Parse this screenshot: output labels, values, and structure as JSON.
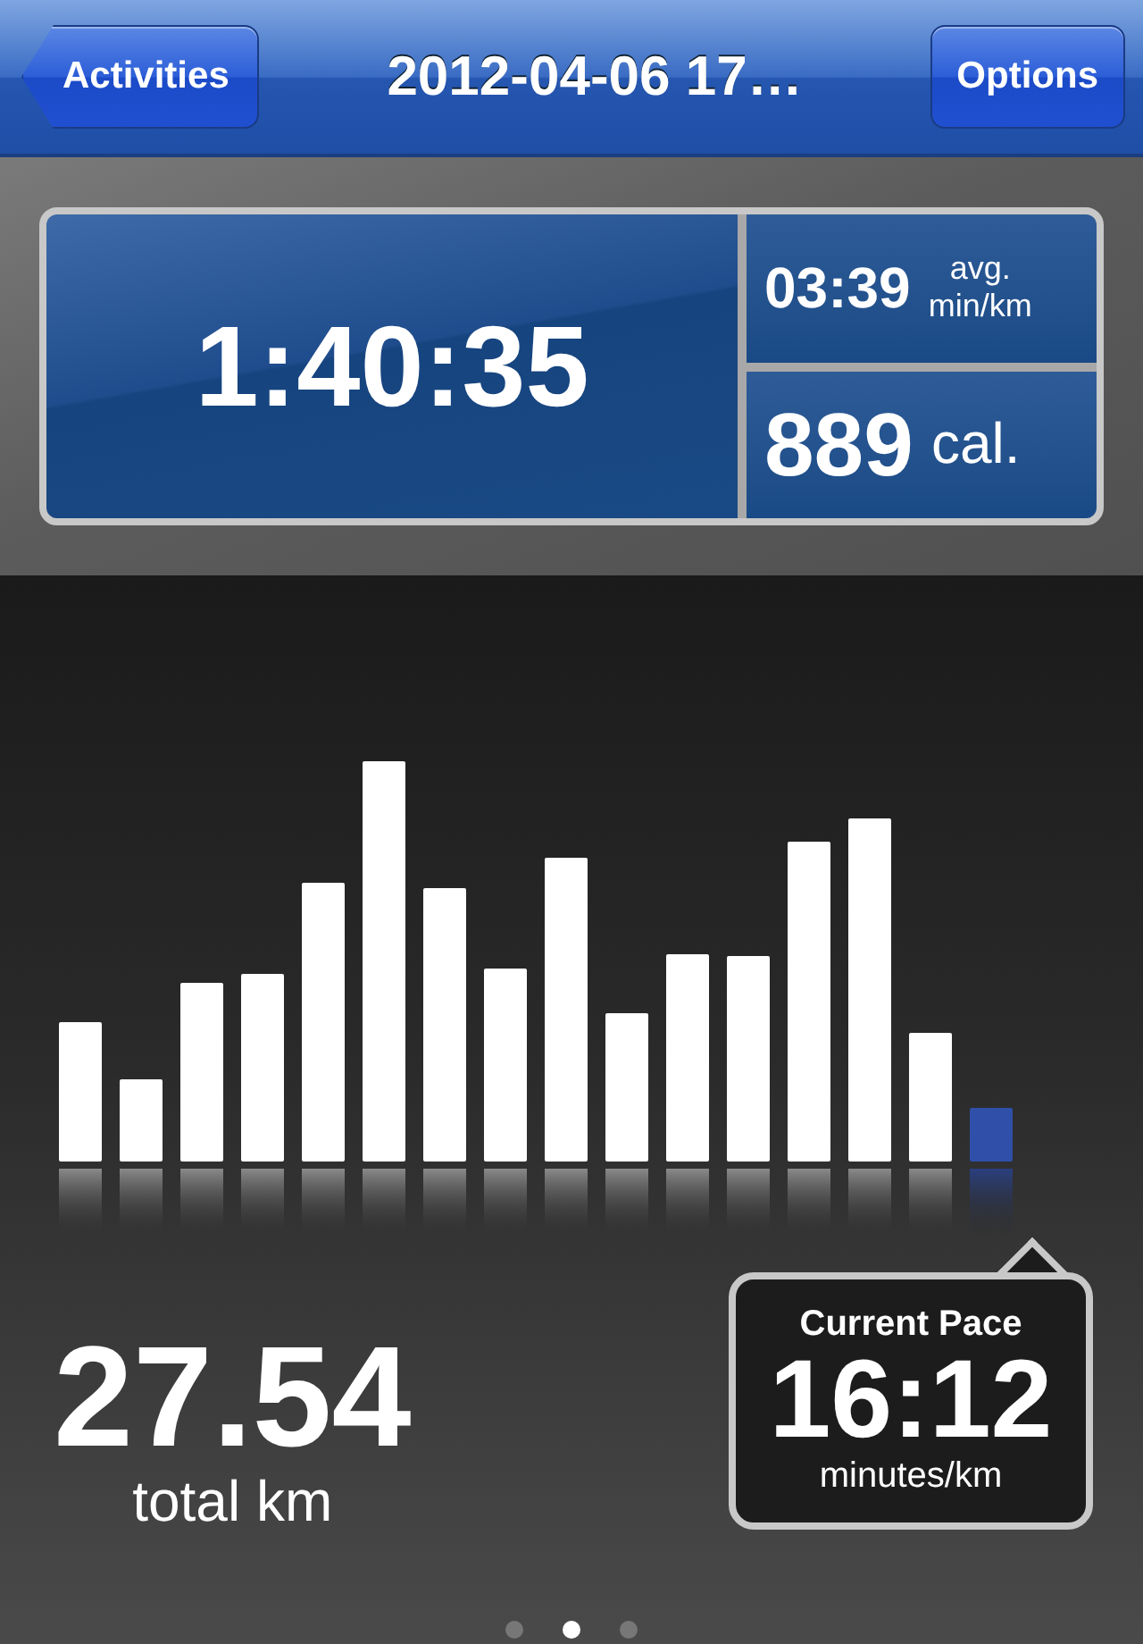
{
  "nav_bar": {
    "back_button": "Activities",
    "title": "2012-04-06 17…",
    "options_button": "Options"
  },
  "stats": {
    "duration": "1:40:35",
    "pace": {
      "value": "03:39",
      "unit_line_1": "avg.",
      "unit_line_2": "min/km"
    },
    "calories": {
      "value": "889",
      "unit": "cal."
    }
  },
  "distance": {
    "value": "27.54",
    "unit": "total km"
  },
  "current_pace": {
    "label": "Current Pace",
    "value": "16:12",
    "unit": "minutes/km"
  },
  "pages": [
    {
      "selected": false
    },
    {
      "selected": true
    },
    {
      "selected": false
    }
  ]
}
